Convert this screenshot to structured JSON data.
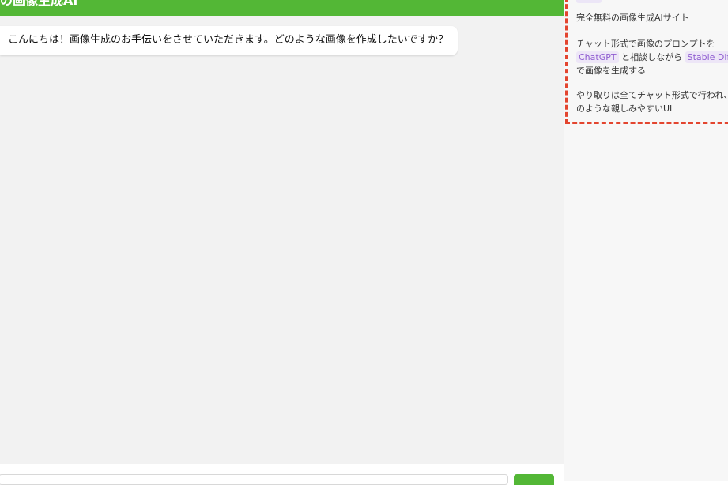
{
  "header": {
    "title": "の画像生成AI"
  },
  "chat": {
    "messages": [
      {
        "role": "assistant",
        "text": "こんにちは！画像生成のお手伝いをさせていただきます。どのような画像を作成したいですか？"
      }
    ]
  },
  "footer": {
    "input_value": "",
    "input_placeholder": "",
    "send_label": ""
  },
  "sidebar": {
    "line1": "完全無料の画像生成AIサイト",
    "para2_line1": "チャット形式で画像のプロンプトを",
    "badge_chatgpt": "ChatGPT",
    "para2_mid": "と相談しながら",
    "badge_sd": "Stable Diffu",
    "para2_line3": "で画像を生成する",
    "para3_line1": "やり取りは全てチャット形式で行われ、",
    "para3_line2": "のような親しみやすいUI"
  },
  "colors": {
    "accent_green": "#53b736",
    "chat_background": "#f2f2f2",
    "highlight_dashed_red": "#e3452f",
    "badge_purple": "#8e5bd0"
  }
}
